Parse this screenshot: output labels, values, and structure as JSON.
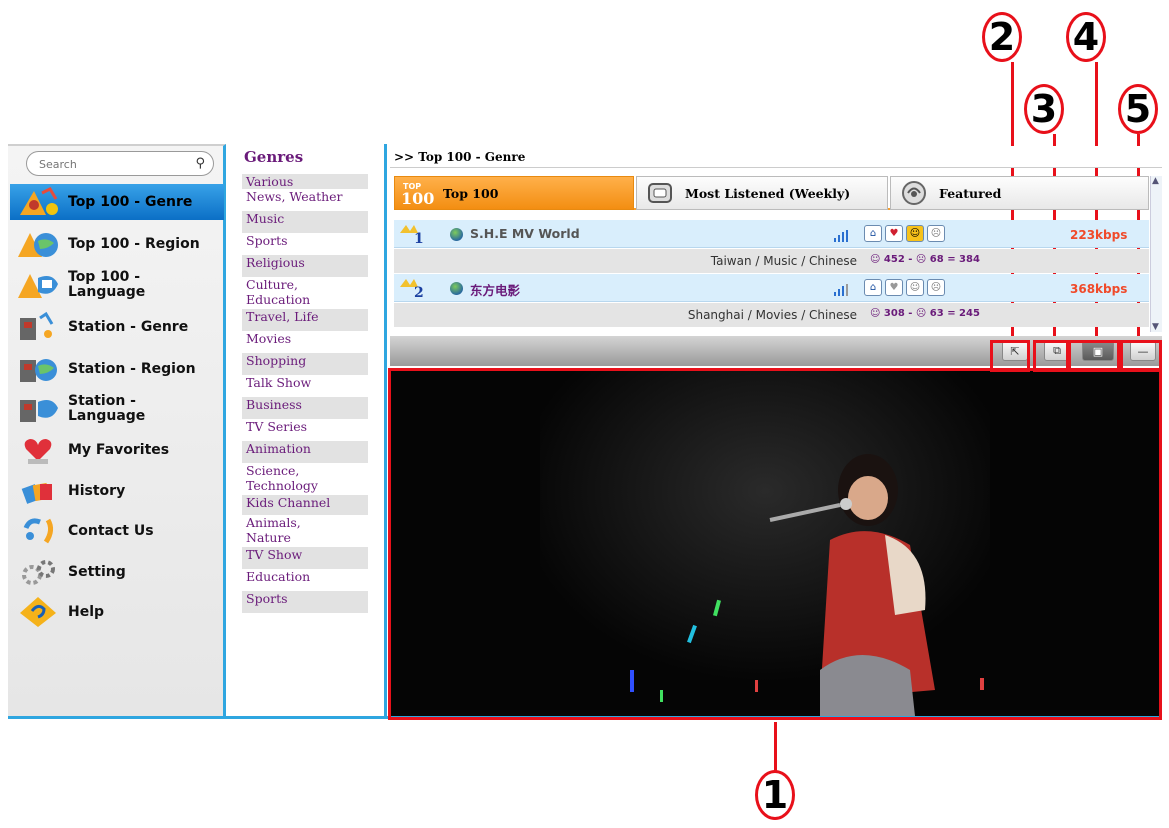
{
  "search": {
    "placeholder": "Search"
  },
  "sidebar": {
    "items": [
      {
        "label": "Top 100 - Genre",
        "icon": "top100-genre-icon",
        "selected": true
      },
      {
        "label": "Top 100 - Region",
        "icon": "top100-region-icon"
      },
      {
        "label": "Top 100 -\nLanguage",
        "icon": "top100-language-icon"
      },
      {
        "label": "Station - Genre",
        "icon": "station-genre-icon"
      },
      {
        "label": "Station - Region",
        "icon": "station-region-icon"
      },
      {
        "label": "Station -\nLanguage",
        "icon": "station-language-icon"
      },
      {
        "label": "My Favorites",
        "icon": "heart-icon"
      },
      {
        "label": "History",
        "icon": "history-icon"
      },
      {
        "label": "Contact Us",
        "icon": "contact-icon"
      },
      {
        "label": "Setting",
        "icon": "gear-icon"
      },
      {
        "label": "Help",
        "icon": "help-icon"
      }
    ]
  },
  "genres": {
    "title": "Genres",
    "items": [
      "Various",
      "News, Weather",
      "Music",
      "Sports",
      "Religious",
      "Culture,\nEducation",
      "Travel, Life",
      "Movies",
      "Shopping",
      "Talk Show",
      "Business",
      "TV Series",
      "Animation",
      "Science,\nTechnology",
      "Kids Channel",
      "Animals,\nNature",
      "TV Show",
      "Education",
      "Sports"
    ]
  },
  "breadcrumb": ">> Top 100 - Genre",
  "tabs": [
    {
      "label": "Top 100",
      "icon": "top100-badge-icon",
      "active": true
    },
    {
      "label": "Most Listened (Weekly)",
      "icon": "tv-icon"
    },
    {
      "label": "Featured",
      "icon": "featured-icon"
    }
  ],
  "top100_badge": {
    "top": "TOP",
    "num": "100"
  },
  "stations": [
    {
      "rank": "1",
      "name": "S.H.E MV World",
      "kbps": "223kbps",
      "location": "Taiwan / Music / Chinese",
      "stats": "☺ 452 - ☹ 68 = 384"
    },
    {
      "rank": "2",
      "name": "东方电影",
      "kbps": "368kbps",
      "location": "Shanghai / Movies / Chinese",
      "stats": "☺ 308 - ☹ 63 = 245"
    }
  ],
  "callouts": [
    "1",
    "2",
    "3",
    "4",
    "5"
  ],
  "colors": {
    "accent_blue": "#2fa6e0",
    "tab_orange": "#f38e12",
    "highlight_red": "#e8101a",
    "genre_purple": "#6a1b7a",
    "kbps_red": "#f04a2a"
  }
}
